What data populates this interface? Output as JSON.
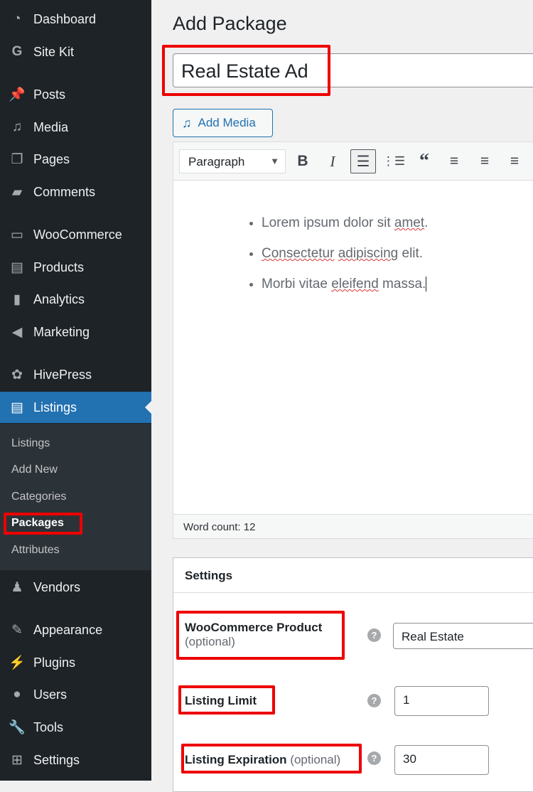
{
  "sidebar": {
    "items": [
      {
        "label": "Dashboard",
        "icon": "dashboard-icon"
      },
      {
        "label": "Site Kit",
        "icon": "google-g-icon"
      },
      {
        "label": "Posts",
        "icon": "pushpin-icon"
      },
      {
        "label": "Media",
        "icon": "media-icon"
      },
      {
        "label": "Pages",
        "icon": "pages-icon"
      },
      {
        "label": "Comments",
        "icon": "comment-icon"
      },
      {
        "label": "WooCommerce",
        "icon": "woocommerce-icon"
      },
      {
        "label": "Products",
        "icon": "archive-icon"
      },
      {
        "label": "Analytics",
        "icon": "bar-chart-icon"
      },
      {
        "label": "Marketing",
        "icon": "megaphone-icon"
      },
      {
        "label": "HivePress",
        "icon": "hivepress-icon"
      },
      {
        "label": "Listings",
        "icon": "listings-icon",
        "active": true
      },
      {
        "label": "Vendors",
        "icon": "vendors-icon"
      },
      {
        "label": "Appearance",
        "icon": "paintbrush-icon"
      },
      {
        "label": "Plugins",
        "icon": "plugin-icon"
      },
      {
        "label": "Users",
        "icon": "user-icon"
      },
      {
        "label": "Tools",
        "icon": "wrench-icon"
      },
      {
        "label": "Settings",
        "icon": "settings-icon"
      }
    ],
    "submenu": [
      "Listings",
      "Add New",
      "Categories",
      "Packages",
      "Attributes"
    ],
    "current_sub": "Packages"
  },
  "page": {
    "title": "Add Package",
    "post_title": "Real Estate Ad"
  },
  "editor": {
    "add_media": "Add Media",
    "format": "Paragraph",
    "list": [
      [
        "Lorem ipsum dolor sit ",
        "amet",
        "."
      ],
      [
        "",
        "Consectetur",
        " ",
        "adipiscing",
        " elit."
      ],
      [
        "Morbi vitae ",
        "eleifend",
        " massa."
      ]
    ],
    "word_count": "Word count: 12"
  },
  "settings": {
    "title": "Settings",
    "product_label": "WooCommerce Product",
    "product_opt": "(optional)",
    "product_value": "Real Estate",
    "limit_label": "Listing Limit",
    "limit_value": "1",
    "exp_label": "Listing Expiration",
    "exp_opt": "(optional)",
    "exp_value": "30"
  },
  "colors": {
    "accent": "#2271b1",
    "sidebar": "#1d2327",
    "highlight": "#e00000"
  }
}
